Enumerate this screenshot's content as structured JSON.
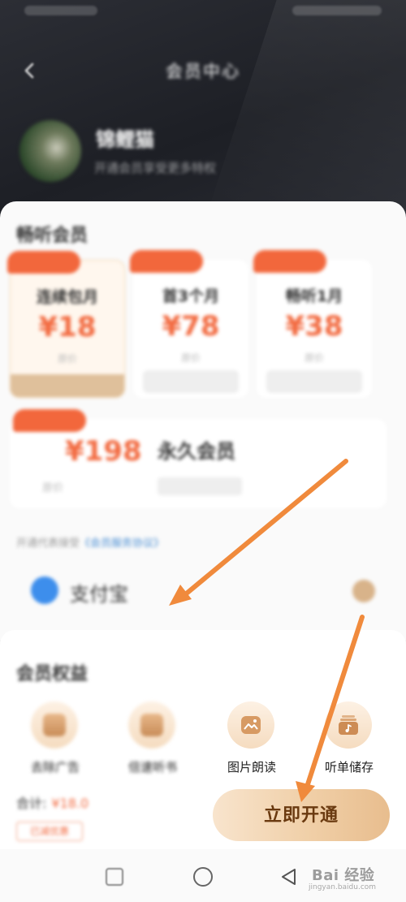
{
  "header": {
    "title": "会员中心",
    "user_name": "锦鲤猫",
    "user_subtitle": "开通会员享受更多特权"
  },
  "plans_section": {
    "title": "畅听会员",
    "plans": [
      {
        "name": "连续包月",
        "price": "¥18",
        "original": "原价",
        "selected": true
      },
      {
        "name": "首3个月",
        "price": "¥78",
        "original": "原价",
        "selected": false
      },
      {
        "name": "畅听1月",
        "price": "¥38",
        "original": "原价",
        "selected": false
      }
    ],
    "wide_plan": {
      "price": "¥198",
      "name": "永久会员",
      "original": "原价"
    },
    "agreement": {
      "prefix": "开通代表接受",
      "link": "《会员服务协议》"
    },
    "payment": {
      "label": "支付宝"
    }
  },
  "privileges": {
    "title": "会员权益",
    "items": [
      {
        "label": "去除广告",
        "icon": "ad-free-icon"
      },
      {
        "label": "倍速听书",
        "icon": "speed-icon"
      },
      {
        "label": "图片朗读",
        "icon": "image-read-icon"
      },
      {
        "label": "听单储存",
        "icon": "playlist-save-icon"
      }
    ],
    "price_label": "合计:",
    "price_value": "¥18.0",
    "coupon": "已减优惠"
  },
  "cta": {
    "label": "立即开通"
  },
  "watermark": {
    "brand": "Bai 经验",
    "url": "jingyan.baidu.com"
  },
  "colors": {
    "header_bg": "#24262c",
    "accent": "#f26a40",
    "gold": "#e8bd8e",
    "arrow": "#f08a3c",
    "link": "#4b8fd4"
  }
}
